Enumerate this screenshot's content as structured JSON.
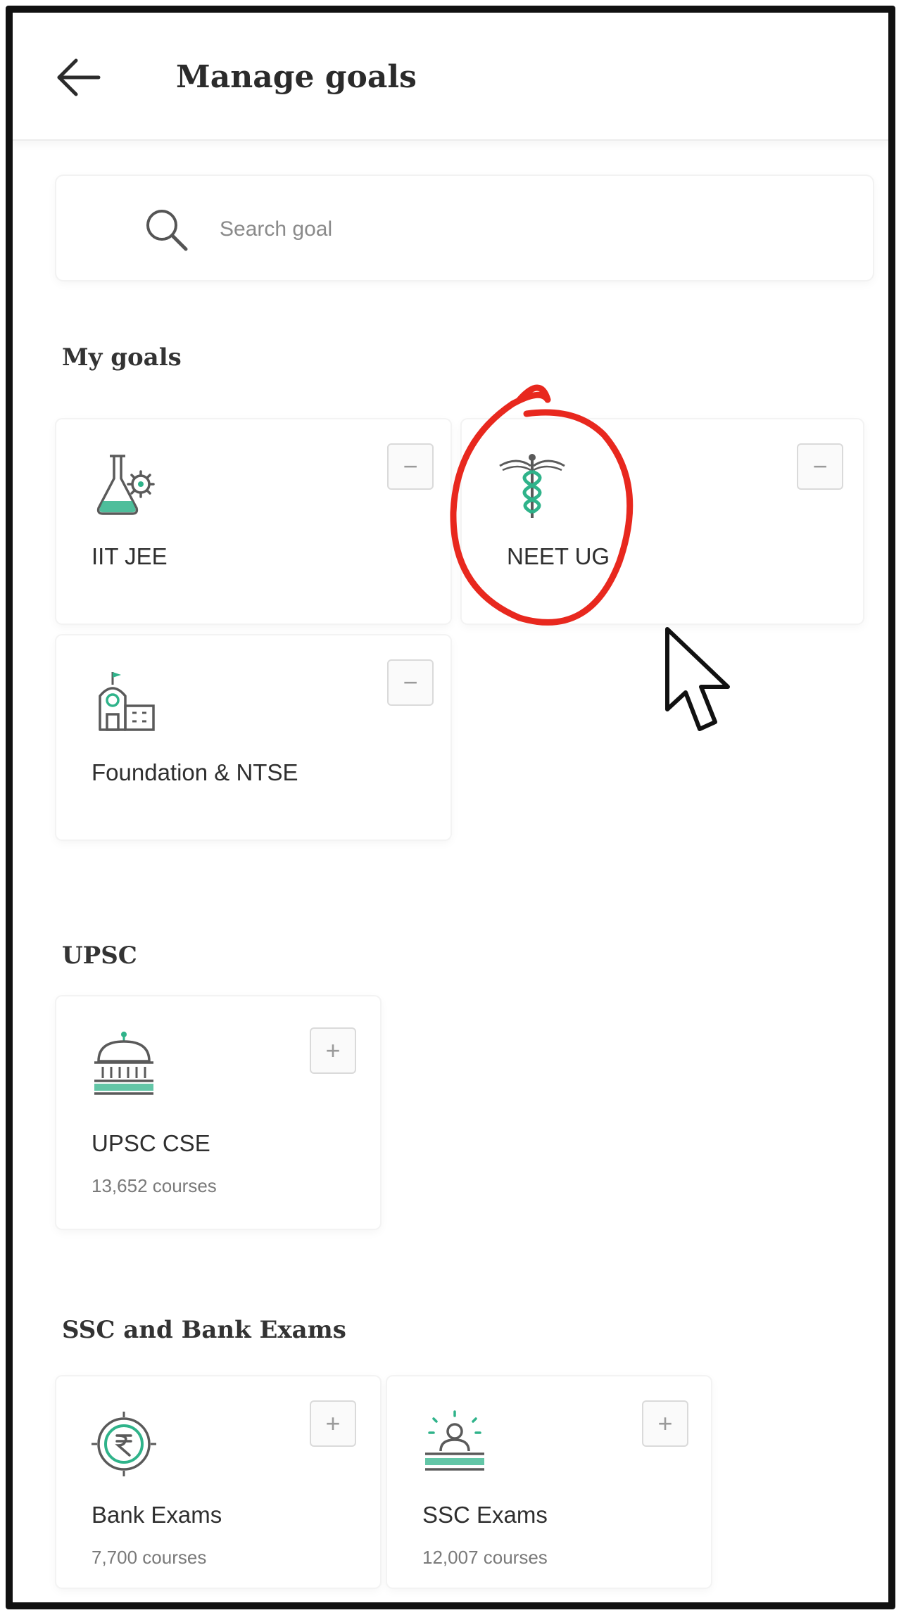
{
  "header": {
    "title": "Manage goals",
    "back_icon": "arrow-left-icon"
  },
  "search": {
    "placeholder": "Search goal",
    "value": "",
    "icon": "search-icon"
  },
  "sections": {
    "my_goals": {
      "title": "My goals",
      "items": [
        {
          "name": "IIT JEE",
          "icon": "flask-gear-icon",
          "action": "−"
        },
        {
          "name": "NEET UG",
          "icon": "caduceus-icon",
          "action": "−"
        },
        {
          "name": "Foundation & NTSE",
          "icon": "school-building-icon",
          "action": "−"
        }
      ]
    },
    "upsc": {
      "title": "UPSC",
      "items": [
        {
          "name": "UPSC CSE",
          "count": "13,652 courses",
          "icon": "parliament-dome-icon",
          "action": "+"
        }
      ]
    },
    "ssc_bank": {
      "title": "SSC and Bank Exams",
      "items": [
        {
          "name": "Bank Exams",
          "count": "7,700 courses",
          "icon": "rupee-coin-icon",
          "action": "+"
        },
        {
          "name": "SSC Exams",
          "count": "12,007 courses",
          "icon": "officer-desk-icon",
          "action": "+"
        }
      ]
    }
  },
  "colors": {
    "accent": "#2fb38a",
    "icon_stroke": "#5a5a5a",
    "annotation": "#e8281e"
  }
}
